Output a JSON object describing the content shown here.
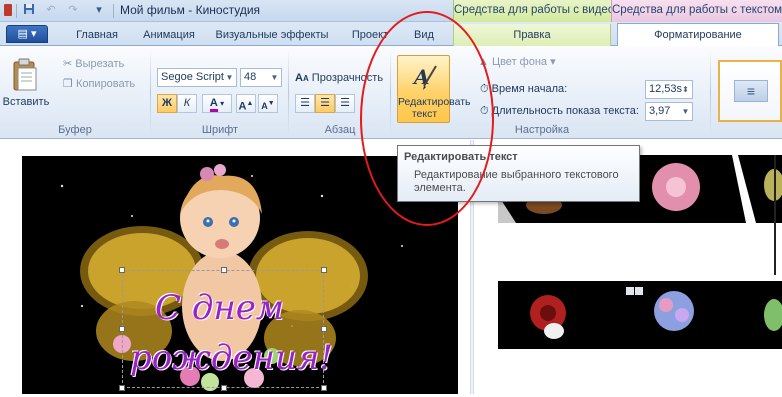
{
  "window": {
    "title": "Мой фильм - Киностудия",
    "quick_access": [
      "save-icon",
      "undo-icon",
      "redo-icon",
      "customize-icon"
    ]
  },
  "context_tabs": {
    "video_tools": "Средства для работы с видео",
    "text_tools": "Средства для работы с текстом"
  },
  "tabs": {
    "file": "▤ ▾",
    "home": "Главная",
    "animation": "Анимация",
    "visual_effects": "Визуальные эффекты",
    "project": "Проект",
    "view": "Вид",
    "edit": "Правка",
    "format": "Форматирование",
    "active": "Форматирование"
  },
  "ribbon": {
    "clipboard": {
      "paste": "Вставить",
      "cut": "Вырезать",
      "copy": "Копировать",
      "label": "Буфер"
    },
    "font": {
      "family": "Segoe Script",
      "size": "48",
      "bold": "Ж",
      "italic": "К",
      "color": "A",
      "grow": "A",
      "shrink": "A",
      "label": "Шрифт"
    },
    "paragraph": {
      "transparency": "Прозрачность",
      "label": "Абзац"
    },
    "settings": {
      "edit_text": "Редактировать текст",
      "bg_color": "Цвет фона",
      "start_time_label": "Время начала:",
      "start_time_value": "12,53s",
      "duration_label": "Длительность показа текста:",
      "duration_value": "3,97",
      "label": "Настройка"
    }
  },
  "tooltip": {
    "title": "Редактировать текст",
    "body": "Редактирование выбранного текстового элемента."
  },
  "preview": {
    "caption_line1": "С днем",
    "caption_line2": "рождения!"
  },
  "colors": {
    "annotation": "#e21b1b",
    "caption": "#9a22c8",
    "video_tools": "#d3ea9c",
    "text_tools": "#eac7e1"
  }
}
